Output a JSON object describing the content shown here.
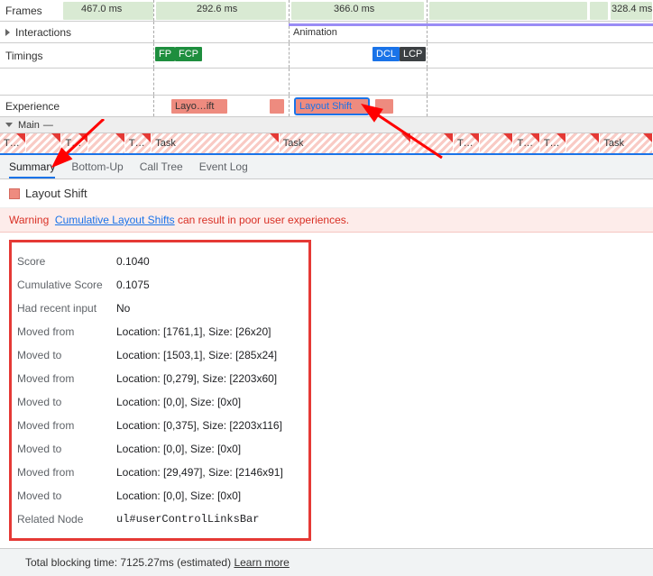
{
  "rows": {
    "frames": "Frames",
    "interactions": "Interactions",
    "timings": "Timings",
    "experience": "Experience",
    "main": "Main"
  },
  "frames_times": {
    "a": "467.0 ms",
    "b": "292.6 ms",
    "c": "366.0 ms",
    "d": "328.4 ms"
  },
  "interactions_label": "Animation",
  "timings": {
    "fp": "FP",
    "fcp": "FCP",
    "dcl": "DCL",
    "lcp": "LCP"
  },
  "experience": {
    "layoshift": "Layo…ift",
    "layoutshift": "Layout Shift"
  },
  "tasks": {
    "short": "T…",
    "task": "Task"
  },
  "tabs": {
    "summary": "Summary",
    "bottomup": "Bottom-Up",
    "calltree": "Call Tree",
    "eventlog": "Event Log"
  },
  "summary_title": "Layout Shift",
  "warning": {
    "prefix": "Warning",
    "link": "Cumulative Layout Shifts",
    "suffix": " can result in poor user experiences."
  },
  "details": [
    {
      "k": "Score",
      "v": "0.1040"
    },
    {
      "k": "Cumulative Score",
      "v": "0.1075"
    },
    {
      "k": "Had recent input",
      "v": "No"
    },
    {
      "k": "Moved from",
      "v": "Location: [1761,1], Size: [26x20]"
    },
    {
      "k": "Moved to",
      "v": "Location: [1503,1], Size: [285x24]"
    },
    {
      "k": "Moved from",
      "v": "Location: [0,279], Size: [2203x60]"
    },
    {
      "k": "Moved to",
      "v": "Location: [0,0], Size: [0x0]"
    },
    {
      "k": "Moved from",
      "v": "Location: [0,375], Size: [2203x116]"
    },
    {
      "k": "Moved to",
      "v": "Location: [0,0], Size: [0x0]"
    },
    {
      "k": "Moved from",
      "v": "Location: [29,497], Size: [2146x91]"
    },
    {
      "k": "Moved to",
      "v": "Location: [0,0], Size: [0x0]"
    }
  ],
  "related": {
    "k": "Related Node",
    "v": "ul#userControlLinksBar"
  },
  "footer": {
    "text": "Total blocking time: 7125.27ms (estimated) ",
    "link": "Learn more"
  }
}
